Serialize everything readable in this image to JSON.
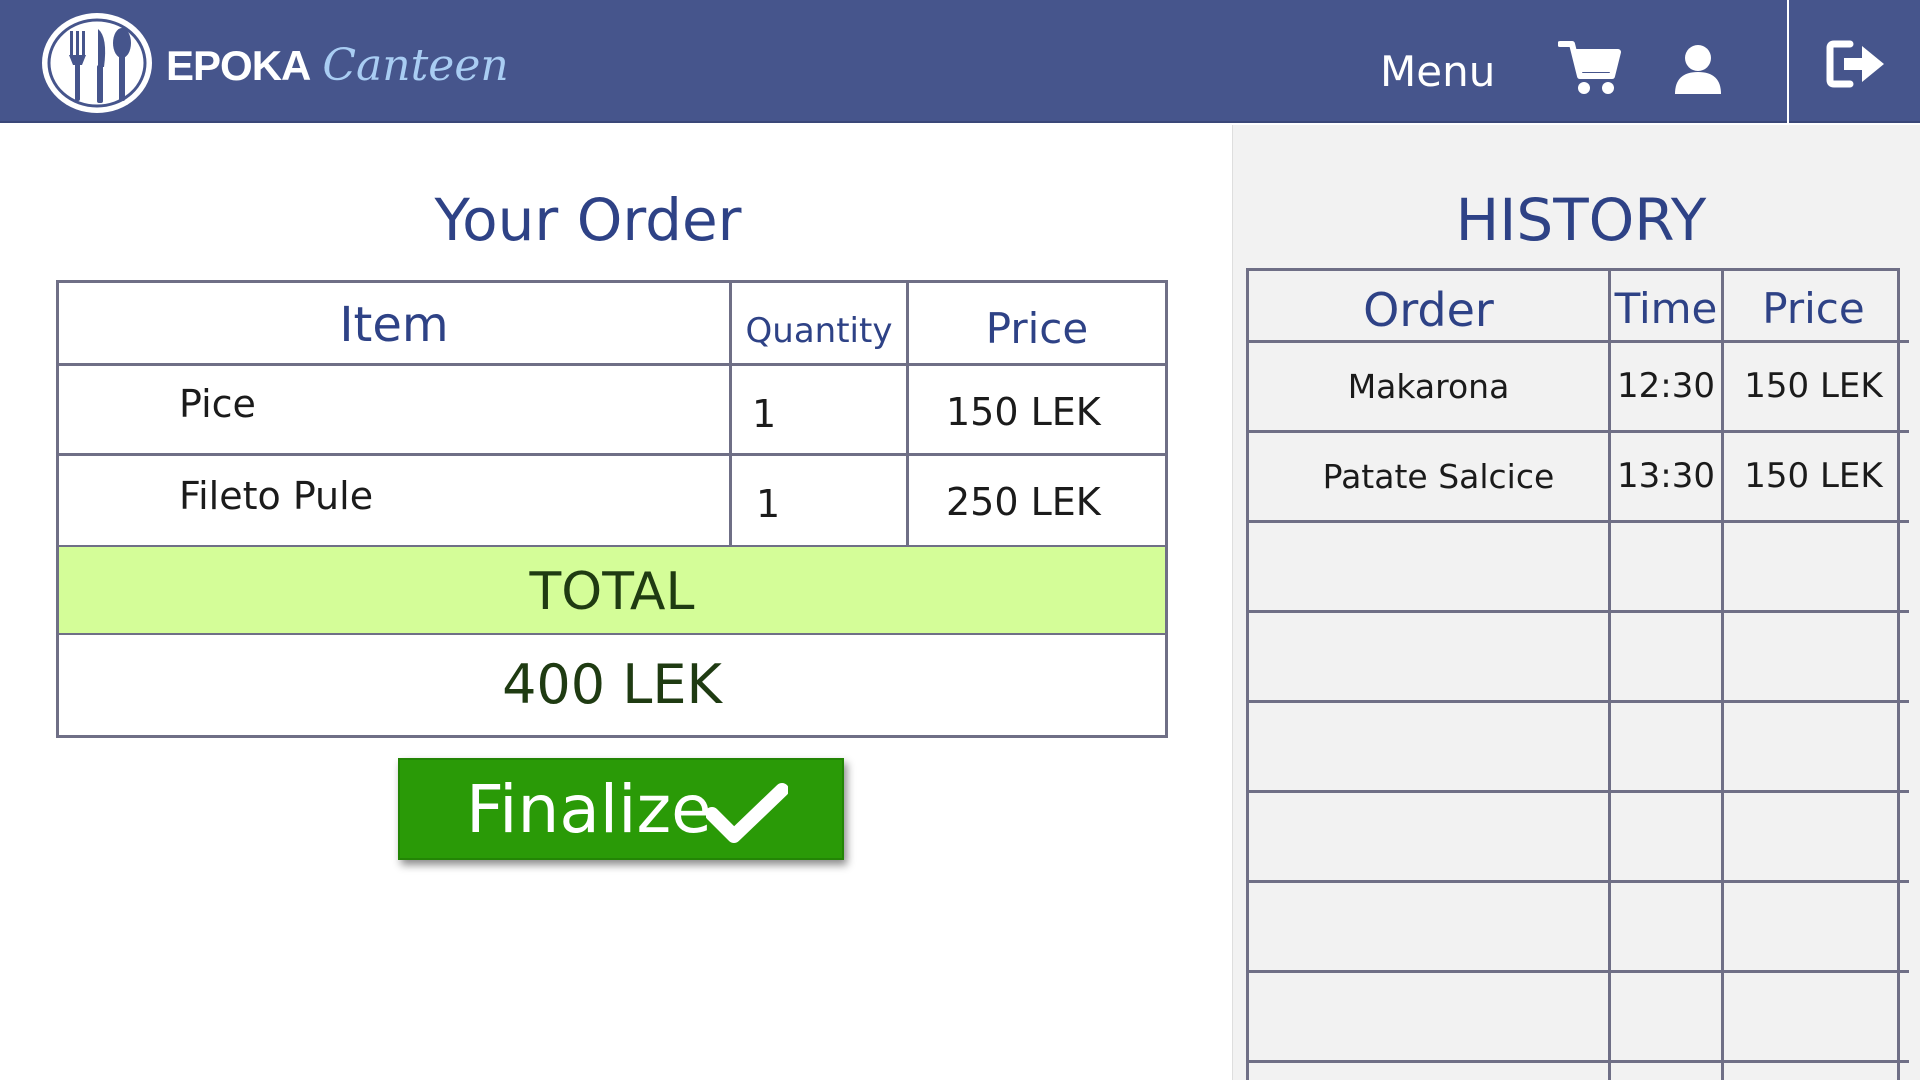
{
  "header": {
    "brand_strong": "EPOKA",
    "brand_script": "Canteen",
    "logo_icon": "fork-knife-spoon-icon",
    "nav_menu_label": "Menu",
    "cart_icon": "cart-icon",
    "user_icon": "user-icon",
    "logout_icon": "logout-icon",
    "background_color": "#46558c"
  },
  "order": {
    "title": "Your Order",
    "columns": {
      "item": "Item",
      "quantity": "Quantity",
      "price": "Price"
    },
    "rows": [
      {
        "item": "Pice",
        "quantity": "1",
        "price": "150 LEK"
      },
      {
        "item": "Fileto Pule",
        "quantity": "1",
        "price": "250 LEK"
      }
    ],
    "total_label": "TOTAL",
    "total_value": "400 LEK",
    "total_band_color": "#d4fd98",
    "finalize_label": "Finalize",
    "finalize_icon": "check-icon",
    "finalize_color": "#2a9a07"
  },
  "history": {
    "title": "HISTORY",
    "columns": {
      "order": "Order",
      "time": "Time",
      "price": "Price"
    },
    "rows": [
      {
        "order": "Makarona",
        "time": "12:30",
        "price": "150 LEK"
      },
      {
        "order": "Patate Salcice",
        "time": "13:30",
        "price": "150 LEK"
      }
    ]
  }
}
